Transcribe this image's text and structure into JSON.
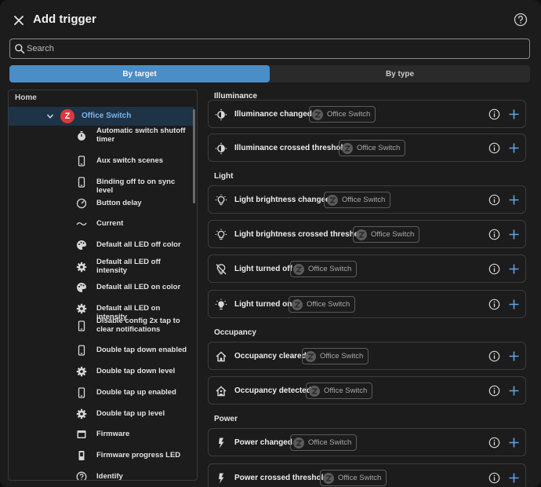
{
  "dialog": {
    "title": "Add trigger"
  },
  "search": {
    "placeholder": "Search"
  },
  "tabs": [
    {
      "label": "By target",
      "active": true
    },
    {
      "label": "By type",
      "active": false
    }
  ],
  "tree": {
    "home_label": "Home",
    "device": {
      "label": "Office Switch",
      "logo": "Z"
    },
    "items": [
      {
        "label": "Automatic switch shutoff timer",
        "icon": "timer-icon"
      },
      {
        "label": "Aux switch scenes",
        "icon": "phone-icon"
      },
      {
        "label": "Binding off to on sync level",
        "icon": "phone-icon"
      },
      {
        "label": "Button delay",
        "icon": "gauge-icon"
      },
      {
        "label": "Current",
        "icon": "current-icon"
      },
      {
        "label": "Default all LED off color",
        "icon": "palette-icon"
      },
      {
        "label": "Default all LED off intensity",
        "icon": "cog-icon"
      },
      {
        "label": "Default all LED on color",
        "icon": "palette-icon"
      },
      {
        "label": "Default all LED on intensity",
        "icon": "cog-icon"
      },
      {
        "label": "Disable config 2x tap to clear notifications",
        "icon": "phone-icon"
      },
      {
        "label": "Double tap down enabled",
        "icon": "phone-icon"
      },
      {
        "label": "Double tap down level",
        "icon": "cog-icon"
      },
      {
        "label": "Double tap up enabled",
        "icon": "phone-icon"
      },
      {
        "label": "Double tap up level",
        "icon": "cog-icon"
      },
      {
        "label": "Firmware",
        "icon": "firmware-icon"
      },
      {
        "label": "Firmware progress LED",
        "icon": "switch-icon"
      },
      {
        "label": "Identify",
        "icon": "help-icon"
      }
    ]
  },
  "sections": [
    {
      "title": "Illuminance",
      "items": [
        {
          "label": "Illuminance changed",
          "icon": "brightness-icon"
        },
        {
          "label": "Illuminance crossed threshold",
          "icon": "brightness-icon"
        }
      ]
    },
    {
      "title": "Light",
      "items": [
        {
          "label": "Light brightness changed",
          "icon": "bulb-icon"
        },
        {
          "label": "Light brightness crossed threshold",
          "icon": "bulb-icon"
        },
        {
          "label": "Light turned off",
          "icon": "bulb-off-icon"
        },
        {
          "label": "Light turned on",
          "icon": "bulb-on-icon"
        }
      ]
    },
    {
      "title": "Occupancy",
      "items": [
        {
          "label": "Occupancy cleared",
          "icon": "home-outline-icon"
        },
        {
          "label": "Occupancy detected",
          "icon": "home-filled-icon"
        }
      ]
    },
    {
      "title": "Power",
      "items": [
        {
          "label": "Power changed",
          "icon": "flash-icon"
        },
        {
          "label": "Power crossed threshold",
          "icon": "flash-icon"
        }
      ]
    }
  ],
  "chip_label": "Office Switch",
  "colors": {
    "accent": "#4a8ec7",
    "device_logo": "#d93a3a",
    "plus": "#5fa3e8"
  }
}
